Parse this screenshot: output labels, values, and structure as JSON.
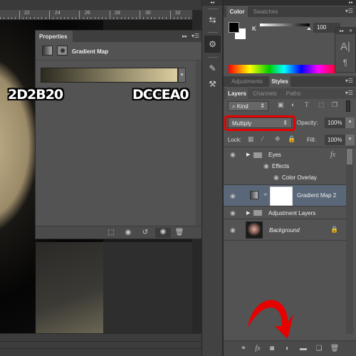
{
  "canvas": {
    "ruler_ticks": [
      "22",
      "24",
      "26",
      "28",
      "30",
      "32"
    ]
  },
  "overlay_labels": {
    "left_stop": "2D2B20",
    "right_stop": "DCCEA0"
  },
  "properties_panel": {
    "tab_label": "Properties",
    "collapse_icon": "double-arrow-right-icon",
    "menu_icon": "panel-menu-icon",
    "adjustment_title": "Gradient Map",
    "gradient": {
      "start_color": "#2D2B20",
      "end_color": "#DCCEA0"
    },
    "footer_icons": [
      "clip-to-layer-icon",
      "view-previous-state-icon",
      "reset-icon",
      "toggle-visibility-icon",
      "delete-icon"
    ]
  },
  "dock": {
    "collapse_label": "◂◂",
    "buttons": [
      "history-icon",
      "properties-icon",
      "brush-presets-icon",
      "tool-presets-icon"
    ]
  },
  "color_panel": {
    "tabs": [
      {
        "label": "Color",
        "active": true
      },
      {
        "label": "Swatches",
        "active": false
      }
    ],
    "channel_label": "K",
    "channel_value": "100",
    "foreground": "#000000",
    "background": "#FFFFFF"
  },
  "character_panel": {
    "icons": [
      "character-icon",
      "paragraph-icon"
    ]
  },
  "adjustments_tabs": [
    {
      "label": "Adjustments",
      "active": false
    },
    {
      "label": "Styles",
      "active": true
    }
  ],
  "layers_panel": {
    "tabs": [
      {
        "label": "Layers",
        "active": true
      },
      {
        "label": "Channels",
        "active": false
      },
      {
        "label": "Paths",
        "active": false
      }
    ],
    "filter_kind": "Kind",
    "filter_icons": [
      "pixel-filter-icon",
      "adjustment-filter-icon",
      "type-filter-icon",
      "shape-filter-icon",
      "smart-object-filter-icon"
    ],
    "blend_mode": "Multiply",
    "opacity_label": "Opacity:",
    "opacity_value": "100%",
    "lock_label": "Lock:",
    "lock_icons": [
      "lock-transparent-icon",
      "lock-image-icon",
      "lock-position-icon",
      "lock-all-icon"
    ],
    "fill_label": "Fill:",
    "fill_value": "100%",
    "layers": [
      {
        "name": "Eyes",
        "type": "group",
        "fx": "fx",
        "effects_label": "Effects",
        "effect": "Color Overlay"
      },
      {
        "name": "Gradient Map 2",
        "type": "adjustment",
        "selected": true
      },
      {
        "name": "Adjustment Layers",
        "type": "group"
      },
      {
        "name": "Background",
        "type": "image",
        "locked": true
      }
    ],
    "footer_icons": [
      "link-layers-icon",
      "add-style-icon",
      "add-mask-icon",
      "new-adjustment-layer-icon",
      "new-group-icon",
      "new-layer-icon",
      "delete-layer-icon"
    ]
  },
  "annotation": {
    "color": "#e60000",
    "points_to": "new-adjustment-layer-icon"
  }
}
